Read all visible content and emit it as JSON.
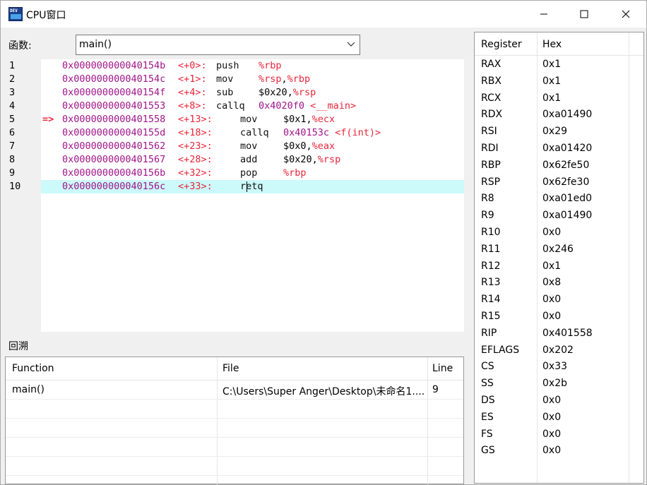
{
  "window": {
    "title": "CPU窗口",
    "icon": "devcpp-app-icon"
  },
  "function_selector": {
    "label": "函数:",
    "value": "main()"
  },
  "disassembly": [
    {
      "line": "1",
      "arrow": "",
      "addr": "0x000000000040154b",
      "offset": "<+0>:",
      "mnemonic": "push",
      "operands": [
        [
          "reg",
          "%rbp"
        ]
      ]
    },
    {
      "line": "2",
      "arrow": "",
      "addr": "0x000000000040154c",
      "offset": "<+1>:",
      "mnemonic": "mov",
      "operands": [
        [
          "reg",
          "%rsp"
        ],
        [
          "plain",
          ","
        ],
        [
          "reg",
          "%rbp"
        ]
      ]
    },
    {
      "line": "3",
      "arrow": "",
      "addr": "0x000000000040154f",
      "offset": "<+4>:",
      "mnemonic": "sub",
      "operands": [
        [
          "plain",
          "$0x20,"
        ],
        [
          "reg",
          "%rsp"
        ]
      ]
    },
    {
      "line": "4",
      "arrow": "",
      "addr": "0x0000000000401553",
      "offset": "<+8>:",
      "mnemonic": "callq",
      "operands": [
        [
          "imm",
          "0x4020f0 "
        ],
        [
          "reg",
          "<__main>"
        ]
      ]
    },
    {
      "line": "5",
      "arrow": "=>",
      "addr": "0x0000000000401558",
      "offset": "<+13>:",
      "mnemonic": "mov",
      "operands": [
        [
          "plain",
          "$0x1,"
        ],
        [
          "reg",
          "%ecx"
        ]
      ]
    },
    {
      "line": "6",
      "arrow": "",
      "addr": "0x000000000040155d",
      "offset": "<+18>:",
      "mnemonic": "callq",
      "operands": [
        [
          "imm",
          "0x40153c "
        ],
        [
          "reg",
          "<f(int)>"
        ]
      ]
    },
    {
      "line": "7",
      "arrow": "",
      "addr": "0x0000000000401562",
      "offset": "<+23>:",
      "mnemonic": "mov",
      "operands": [
        [
          "plain",
          "$0x0,"
        ],
        [
          "reg",
          "%eax"
        ]
      ]
    },
    {
      "line": "8",
      "arrow": "",
      "addr": "0x0000000000401567",
      "offset": "<+28>:",
      "mnemonic": "add",
      "operands": [
        [
          "plain",
          "$0x20,"
        ],
        [
          "reg",
          "%rsp"
        ]
      ]
    },
    {
      "line": "9",
      "arrow": "",
      "addr": "0x000000000040156b",
      "offset": "<+32>:",
      "mnemonic": "pop",
      "operands": [
        [
          "reg",
          "%rbp"
        ]
      ]
    },
    {
      "line": "10",
      "arrow": "",
      "addr": "0x000000000040156c",
      "offset": "<+33>:",
      "mnemonic": "retq",
      "operands": [],
      "current": true
    }
  ],
  "backtrace": {
    "label": "回溯",
    "columns": [
      "Function",
      "File",
      "Line"
    ],
    "rows": [
      [
        "main()",
        "C:\\Users\\Super Anger\\Desktop\\未命名1....",
        "9"
      ]
    ]
  },
  "registers": {
    "columns": [
      "Register",
      "Hex"
    ],
    "rows": [
      [
        "RAX",
        "0x1"
      ],
      [
        "RBX",
        "0x1"
      ],
      [
        "RCX",
        "0x1"
      ],
      [
        "RDX",
        "0xa01490"
      ],
      [
        "RSI",
        "0x29"
      ],
      [
        "RDI",
        "0xa01420"
      ],
      [
        "RBP",
        "0x62fe50"
      ],
      [
        "RSP",
        "0x62fe30"
      ],
      [
        "R8",
        "0xa01ed0"
      ],
      [
        "R9",
        "0xa01490"
      ],
      [
        "R10",
        "0x0"
      ],
      [
        "R11",
        "0x246"
      ],
      [
        "R12",
        "0x1"
      ],
      [
        "R13",
        "0x8"
      ],
      [
        "R14",
        "0x0"
      ],
      [
        "R15",
        "0x0"
      ],
      [
        "RIP",
        "0x401558"
      ],
      [
        "EFLAGS",
        "0x202"
      ],
      [
        "CS",
        "0x33"
      ],
      [
        "SS",
        "0x2b"
      ],
      [
        "DS",
        "0x0"
      ],
      [
        "ES",
        "0x0"
      ],
      [
        "FS",
        "0x0"
      ],
      [
        "GS",
        "0x0"
      ]
    ]
  },
  "colors": {
    "current_line": "#ccf9f9",
    "address": "#a0158a",
    "register": "#e8263a"
  }
}
